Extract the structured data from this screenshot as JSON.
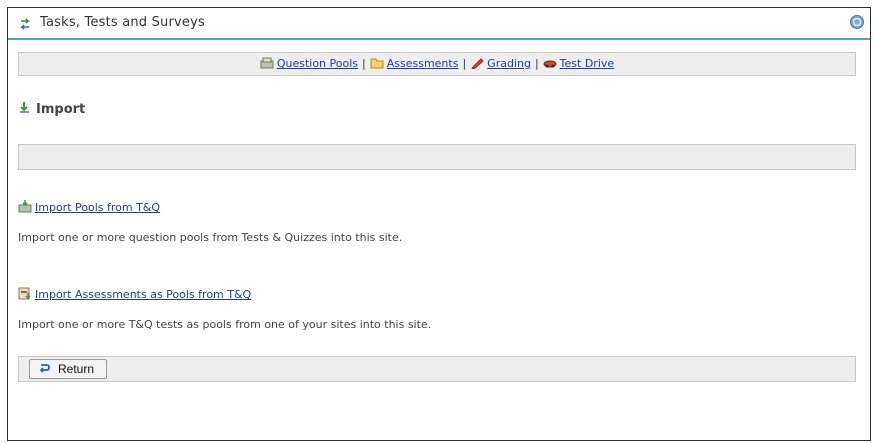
{
  "header": {
    "title": "Tasks, Tests and Surveys",
    "title_icon": "arrows-icon",
    "help_icon": "help-icon"
  },
  "nav": {
    "question_pools": "Question Pools",
    "assessments": "Assessments",
    "grading": "Grading",
    "test_drive": "Test Drive",
    "separator": "|"
  },
  "section": {
    "heading": "Import"
  },
  "items": [
    {
      "link": "Import Pools from T&Q",
      "description": "Import one or more question pools from Tests & Quizzes into this site."
    },
    {
      "link": "Import Assessments as Pools from T&Q",
      "description": "Import one or more T&Q tests as pools from one of your sites into this site."
    }
  ],
  "footer": {
    "return_label": "Return"
  },
  "colors": {
    "accent": "#4aa3cf",
    "link": "#1f3e9c",
    "bar_bg": "#eeeeee"
  }
}
